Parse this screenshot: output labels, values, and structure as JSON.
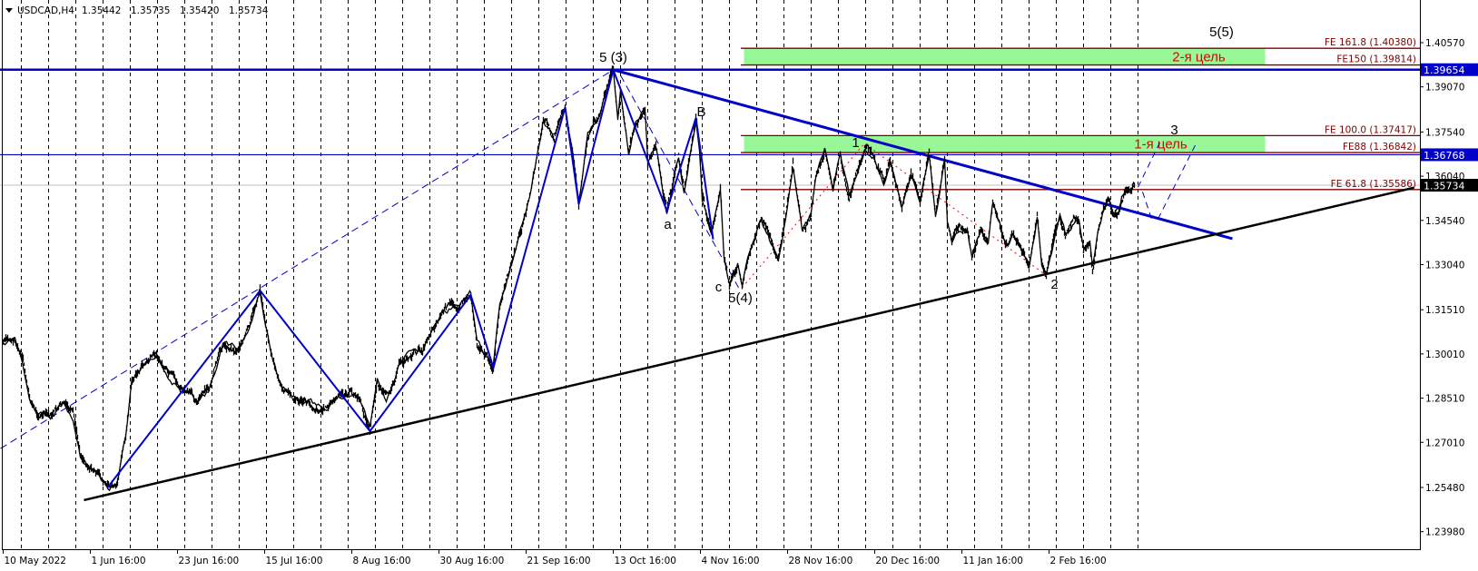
{
  "header": {
    "symbol": "USDCAD,H4",
    "open": "1.35442",
    "high": "1.35735",
    "low": "1.35420",
    "close": "1.35734"
  },
  "colors": {
    "price": "#000000",
    "wave": "#0000c8",
    "level": "#0000c8",
    "fe": "#800000",
    "zone": "#98f898",
    "zone_text": "#e00000",
    "support": "#000000",
    "red_dotted": "#ff0000",
    "current": "#c0c0c0"
  },
  "chart_data": {
    "type": "line",
    "title": "USDCAD,H4",
    "xlabel": "",
    "ylabel": "",
    "ylim": [
      1.2315,
      1.413
    ],
    "grid": "vertical-dashed",
    "y_ticks": [
      "1.40570",
      "1.39070",
      "1.37540",
      "1.36040",
      "1.34540",
      "1.33040",
      "1.31510",
      "1.30010",
      "1.28510",
      "1.27010",
      "1.25480",
      "1.23980"
    ],
    "x_ticks": [
      {
        "label": "10 May 2022",
        "bar": 3
      },
      {
        "label": "1 Jun 16:00",
        "bar": 99
      },
      {
        "label": "23 Jun 16:00",
        "bar": 195
      },
      {
        "label": "15 Jul 16:00",
        "bar": 291
      },
      {
        "label": "8 Aug 16:00",
        "bar": 387
      },
      {
        "label": "30 Aug 16:00",
        "bar": 483
      },
      {
        "label": "21 Sep 16:00",
        "bar": 579
      },
      {
        "label": "13 Oct 16:00",
        "bar": 675
      },
      {
        "label": "4 Nov 16:00",
        "bar": 771
      },
      {
        "label": "28 Nov 16:00",
        "bar": 867
      },
      {
        "label": "20 Dec 16:00",
        "bar": 963
      },
      {
        "label": "11 Jan 16:00",
        "bar": 1059
      },
      {
        "label": "2 Feb 16:00",
        "bar": 1155
      }
    ],
    "price_series": [
      [
        3,
        1.3041
      ],
      [
        16,
        1.3047
      ],
      [
        25,
        1.297
      ],
      [
        32,
        1.2847
      ],
      [
        40,
        1.28
      ],
      [
        55,
        1.2785
      ],
      [
        70,
        1.2831
      ],
      [
        80,
        1.2785
      ],
      [
        88,
        1.2662
      ],
      [
        105,
        1.26
      ],
      [
        118,
        1.2548
      ],
      [
        128,
        1.2554
      ],
      [
        138,
        1.2723
      ],
      [
        145,
        1.2908
      ],
      [
        155,
        1.2954
      ],
      [
        172,
        1.3001
      ],
      [
        185,
        1.2924
      ],
      [
        200,
        1.2877
      ],
      [
        215,
        1.2847
      ],
      [
        230,
        1.2877
      ],
      [
        245,
        1.3031
      ],
      [
        260,
        1.3016
      ],
      [
        275,
        1.3093
      ],
      [
        286,
        1.3216
      ],
      [
        292,
        1.3108
      ],
      [
        300,
        1.2985
      ],
      [
        310,
        1.2877
      ],
      [
        325,
        1.2847
      ],
      [
        340,
        1.2831
      ],
      [
        355,
        1.2816
      ],
      [
        370,
        1.2847
      ],
      [
        385,
        1.2871
      ],
      [
        395,
        1.2847
      ],
      [
        407,
        1.2739
      ],
      [
        415,
        1.2908
      ],
      [
        425,
        1.2847
      ],
      [
        440,
        1.297
      ],
      [
        455,
        1.3001
      ],
      [
        465,
        1.3016
      ],
      [
        475,
        1.3093
      ],
      [
        490,
        1.3155
      ],
      [
        505,
        1.317
      ],
      [
        518,
        1.3201
      ],
      [
        525,
        1.3047
      ],
      [
        543,
        1.2954
      ],
      [
        550,
        1.315
      ],
      [
        563,
        1.3299
      ],
      [
        583,
        1.3533
      ],
      [
        598,
        1.3792
      ],
      [
        610,
        1.374
      ],
      [
        622,
        1.3838
      ],
      [
        632,
        1.3638
      ],
      [
        637,
        1.3509
      ],
      [
        647,
        1.374
      ],
      [
        660,
        1.3823
      ],
      [
        675,
        1.3965
      ],
      [
        680,
        1.3792
      ],
      [
        683,
        1.3885
      ],
      [
        692,
        1.3687
      ],
      [
        700,
        1.3792
      ],
      [
        710,
        1.3841
      ],
      [
        713,
        1.3657
      ],
      [
        722,
        1.3709
      ],
      [
        730,
        1.3555
      ],
      [
        734,
        1.3487
      ],
      [
        747,
        1.3678
      ],
      [
        753,
        1.3564
      ],
      [
        766,
        1.3801
      ],
      [
        770,
        1.3709
      ],
      [
        773,
        1.3533
      ],
      [
        783,
        1.341
      ],
      [
        793,
        1.3555
      ],
      [
        797,
        1.333
      ],
      [
        803,
        1.3238
      ],
      [
        812,
        1.3309
      ],
      [
        817,
        1.3232
      ],
      [
        827,
        1.3361
      ],
      [
        838,
        1.3453
      ],
      [
        847,
        1.3392
      ],
      [
        857,
        1.333
      ],
      [
        865,
        1.3463
      ],
      [
        873,
        1.3638
      ],
      [
        883,
        1.341
      ],
      [
        893,
        1.3472
      ],
      [
        898,
        1.3595
      ],
      [
        908,
        1.3694
      ],
      [
        917,
        1.3564
      ],
      [
        925,
        1.3678
      ],
      [
        935,
        1.3533
      ],
      [
        943,
        1.3617
      ],
      [
        952,
        1.37
      ],
      [
        962,
        1.3678
      ],
      [
        973,
        1.3586
      ],
      [
        980,
        1.3657
      ],
      [
        993,
        1.3493
      ],
      [
        1003,
        1.3607
      ],
      [
        1013,
        1.3524
      ],
      [
        1023,
        1.3684
      ],
      [
        1030,
        1.3472
      ],
      [
        1040,
        1.3657
      ],
      [
        1043,
        1.3441
      ],
      [
        1048,
        1.3379
      ],
      [
        1057,
        1.3432
      ],
      [
        1065,
        1.3432
      ],
      [
        1070,
        1.3339
      ],
      [
        1080,
        1.341
      ],
      [
        1088,
        1.3379
      ],
      [
        1093,
        1.3515
      ],
      [
        1100,
        1.3453
      ],
      [
        1107,
        1.337
      ],
      [
        1115,
        1.3401
      ],
      [
        1123,
        1.337
      ],
      [
        1133,
        1.3302
      ],
      [
        1142,
        1.3463
      ],
      [
        1147,
        1.3309
      ],
      [
        1152,
        1.3268
      ],
      [
        1160,
        1.3379
      ],
      [
        1167,
        1.3463
      ],
      [
        1173,
        1.3401
      ],
      [
        1182,
        1.3453
      ],
      [
        1188,
        1.3453
      ],
      [
        1193,
        1.3349
      ],
      [
        1200,
        1.337
      ],
      [
        1203,
        1.3278
      ],
      [
        1210,
        1.3423
      ],
      [
        1215,
        1.3484
      ],
      [
        1220,
        1.3524
      ],
      [
        1227,
        1.3463
      ],
      [
        1232,
        1.3484
      ],
      [
        1235,
        1.3533
      ],
      [
        1240,
        1.3555
      ],
      [
        1245,
        1.3543
      ],
      [
        1249,
        1.35734
      ]
    ],
    "wave_zigzag": [
      [
        118,
        1.2548
      ],
      [
        286,
        1.3216
      ],
      [
        407,
        1.2739
      ],
      [
        518,
        1.3201
      ],
      [
        543,
        1.2954
      ],
      [
        622,
        1.3838
      ],
      [
        637,
        1.3509
      ],
      [
        675,
        1.3965
      ],
      [
        734,
        1.3487
      ],
      [
        766,
        1.3801
      ],
      [
        785,
        1.339
      ]
    ],
    "trendlines": [
      {
        "name": "resistance-trendline",
        "from": [
          675,
          1.3965
        ],
        "to": [
          1357,
          1.3392
        ],
        "color": "#0000c8",
        "width": 3,
        "dash": ""
      },
      {
        "name": "support-trendline",
        "from": [
          92,
          1.2505
        ],
        "to": [
          1557,
          1.3565
        ],
        "color": "#000000",
        "width": 2.5,
        "dash": ""
      },
      {
        "name": "channel-dashed-line",
        "from": [
          0,
          1.268
        ],
        "to": [
          675,
          1.3965
        ],
        "color": "#0000c8",
        "width": 1,
        "dash": "8,5"
      },
      {
        "name": "correction-dashed-line",
        "from": [
          683,
          1.3946
        ],
        "to": [
          813,
          1.3226
        ],
        "color": "#0000c8",
        "width": 1,
        "dash": "8,5"
      },
      {
        "name": "red-dotted-up-line",
        "from": [
          817,
          1.3226
        ],
        "to": [
          950,
          1.3709
        ],
        "color": "#ff0000",
        "width": 1,
        "dash": "2,4"
      },
      {
        "name": "red-dotted-down-line",
        "from": [
          957,
          1.3703
        ],
        "to": [
          1150,
          1.3272
        ],
        "color": "#ff0000",
        "width": 1,
        "dash": "2,4"
      },
      {
        "name": "projection-dashed-1",
        "from": [
          1253,
          1.3567
        ],
        "to": [
          1277,
          1.3718
        ],
        "color": "#0000c8",
        "width": 1,
        "dash": "7,5"
      },
      {
        "name": "projection-dashed-2",
        "from": [
          1258,
          1.3551
        ],
        "to": [
          1268,
          1.3459
        ],
        "color": "#0000c8",
        "width": 1,
        "dash": "7,5"
      },
      {
        "name": "projection-dashed-3",
        "from": [
          1275,
          1.3459
        ],
        "to": [
          1317,
          1.3715
        ],
        "color": "#0000c8",
        "width": 1,
        "dash": "7,5"
      }
    ],
    "horizontal_levels": [
      {
        "name": "level-1-39654",
        "price": 1.39654,
        "label": "1.39654",
        "color": "#0000c8",
        "width": 2.5,
        "tag_bg": "#0000c8"
      },
      {
        "name": "level-1-36768",
        "price": 1.36768,
        "label": "1.36768",
        "color": "#0000c8",
        "width": 1.2,
        "tag_bg": "#0000c8"
      },
      {
        "name": "current-price-line",
        "price": 1.35734,
        "label": "1.35734",
        "color": "#c0c0c0",
        "width": 1,
        "tag_bg": "#000000"
      }
    ],
    "fe_levels": [
      {
        "label": "FE 161.8 (1.40380)",
        "price": 1.4038
      },
      {
        "label": "FE150 (1.39814)",
        "price": 1.39814
      },
      {
        "label": "FE 100.0 (1.37417)",
        "price": 1.37417
      },
      {
        "label": "FE88 (1.36842)",
        "price": 1.36842
      },
      {
        "label": "FE 61.8 (1.35586)",
        "price": 1.35586
      }
    ],
    "target_zones": [
      {
        "label": "2-я цель",
        "top": 1.4038,
        "bottom": 1.39814,
        "start_bar": 819,
        "end_bar": 1393,
        "label_bar": 1320
      },
      {
        "label": "1-я цель",
        "top": 1.37417,
        "bottom": 1.36842,
        "start_bar": 819,
        "end_bar": 1393,
        "label_bar": 1278
      }
    ],
    "wave_labels": [
      {
        "text": "5 (3)",
        "bar": 675,
        "price": 1.4008
      },
      {
        "text": "a",
        "bar": 735,
        "price": 1.3441
      },
      {
        "text": "B",
        "bar": 772,
        "price": 1.3823
      },
      {
        "text": "c",
        "bar": 791,
        "price": 1.3229
      },
      {
        "text": "5(4)",
        "bar": 815,
        "price": 1.3192
      },
      {
        "text": "1",
        "bar": 942,
        "price": 1.3718
      },
      {
        "text": "2",
        "bar": 1161,
        "price": 1.3238
      },
      {
        "text": "3",
        "bar": 1293,
        "price": 1.3761
      },
      {
        "text": "5(5)",
        "bar": 1345,
        "price": 1.4094
      }
    ]
  }
}
